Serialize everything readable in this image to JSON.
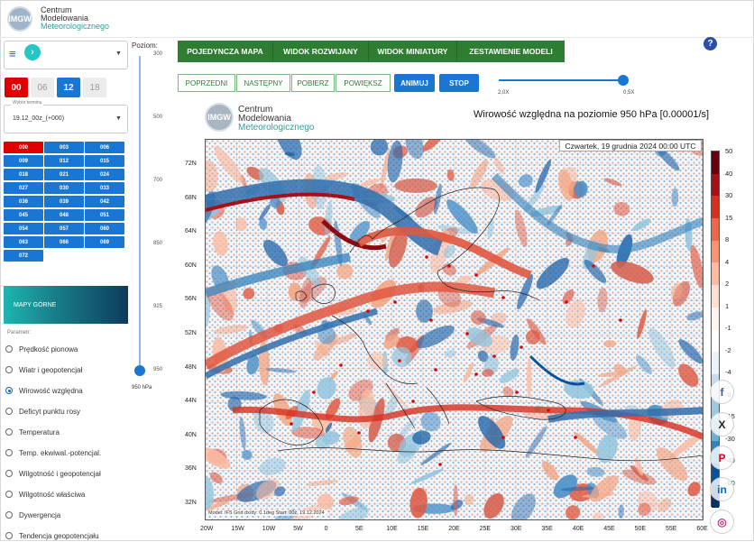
{
  "header": {
    "logo_short": "IMGW",
    "logo_line1": "Centrum",
    "logo_line2": "Modelowania",
    "logo_line3": "Meteorologicznego",
    "help_label": "?"
  },
  "menu": {
    "hamburger": "≡",
    "next": "›"
  },
  "hours": [
    "00",
    "06",
    "12",
    "18"
  ],
  "term": {
    "label": "Wybór terminu",
    "value": "19.12_00z_(+000)"
  },
  "steps": [
    "000",
    "003",
    "006",
    "009",
    "012",
    "015",
    "018",
    "021",
    "024",
    "027",
    "030",
    "033",
    "036",
    "039",
    "042",
    "045",
    "048",
    "051",
    "054",
    "057",
    "060",
    "063",
    "066",
    "069",
    "072"
  ],
  "section": "MAPY GÓRNE",
  "param_label": "Parametr:",
  "params": [
    {
      "label": "Prędkość pionowa",
      "selected": false
    },
    {
      "label": "Wiatr i geopotencjał",
      "selected": false
    },
    {
      "label": "Wirowość względna",
      "selected": true
    },
    {
      "label": "Deficyt punktu rosy",
      "selected": false
    },
    {
      "label": "Temperatura",
      "selected": false
    },
    {
      "label": "Temp. ekwiwal.-potencjal.",
      "selected": false
    },
    {
      "label": "Wilgotność i geopotencjał",
      "selected": false
    },
    {
      "label": "Wilgotność właściwa",
      "selected": false
    },
    {
      "label": "Dywergencja",
      "selected": false
    },
    {
      "label": "Tendencja geopotencjału",
      "selected": false
    }
  ],
  "level": {
    "title": "Poziom:",
    "ticks": [
      "300",
      "500",
      "700",
      "850",
      "925",
      "950"
    ],
    "current": "950 hPa",
    "value": 950
  },
  "tabs": [
    "POJEDYNCZA MAPA",
    "WIDOK ROZWIJANY",
    "WIDOK MINIATURY",
    "ZESTAWIENIE MODELI"
  ],
  "actions": [
    "POPRZEDNI",
    "NASTĘPNY",
    "POBIERZ",
    "POWIĘKSZ"
  ],
  "animate": "ANIMUJ",
  "stop": "STOP",
  "speed": {
    "min_label": "2,0X",
    "max_label": "0,5X",
    "value": 0.95
  },
  "map": {
    "title": "Wirowość względna na poziomie 950 hPa [0.00001/s]",
    "date": "Czwartek, 19 grudnia 2024 00:00 UTC",
    "footer": "Model: IFS   Grid dx/dy: 0.1deg   Start: 00z, 19.12.2024",
    "watermark": "© Prof. Mariusz J. Figurski",
    "lat_labels": [
      "72N",
      "68N",
      "64N",
      "60N",
      "56N",
      "52N",
      "48N",
      "44N",
      "40N",
      "36N",
      "32N"
    ],
    "lon_labels": [
      "20W",
      "15W",
      "10W",
      "5W",
      "0",
      "5E",
      "10E",
      "15E",
      "20E",
      "25E",
      "30E",
      "35E",
      "40E",
      "45E",
      "50E",
      "55E",
      "60E"
    ]
  },
  "colorbar": {
    "labels": [
      "50",
      "40",
      "30",
      "15",
      "8",
      "4",
      "2",
      "1",
      "-1",
      "-2",
      "-4",
      "-8",
      "-15",
      "-30",
      "-40",
      "-50"
    ],
    "colors": [
      "#67000d",
      "#a50f15",
      "#d7301f",
      "#ef6548",
      "#fc9272",
      "#fcbba1",
      "#fee0d2",
      "#fff5f0",
      "#ffffff",
      "#eaf2fb",
      "#c6dbef",
      "#9ecae1",
      "#6baed6",
      "#3182bd",
      "#08519c",
      "#08306b"
    ]
  },
  "social": [
    "f",
    "X",
    "P",
    "in",
    "◎"
  ]
}
